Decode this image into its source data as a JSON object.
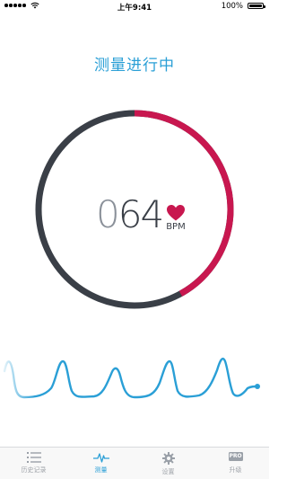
{
  "status_bar": {
    "time": "上午9:41",
    "battery": "100%"
  },
  "screen": {
    "title": "测量进行中"
  },
  "measurement": {
    "bpm_leading": "0",
    "bpm_value": "64",
    "unit": "BPM",
    "progress": 0.42
  },
  "colors": {
    "accent": "#2a9fd6",
    "ring_progress": "#c8174f",
    "ring_remaining": "#3a3f47",
    "heart": "#c8174f",
    "tab_inactive": "#a0a4aa"
  },
  "tabs": [
    {
      "label": "历史记录",
      "icon": "list-icon",
      "active": false
    },
    {
      "label": "测量",
      "icon": "pulse-icon",
      "active": true
    },
    {
      "label": "设置",
      "icon": "gear-icon",
      "active": false
    },
    {
      "label": "升级",
      "icon": "pro-badge-icon",
      "badge": "PRO",
      "active": false
    }
  ]
}
